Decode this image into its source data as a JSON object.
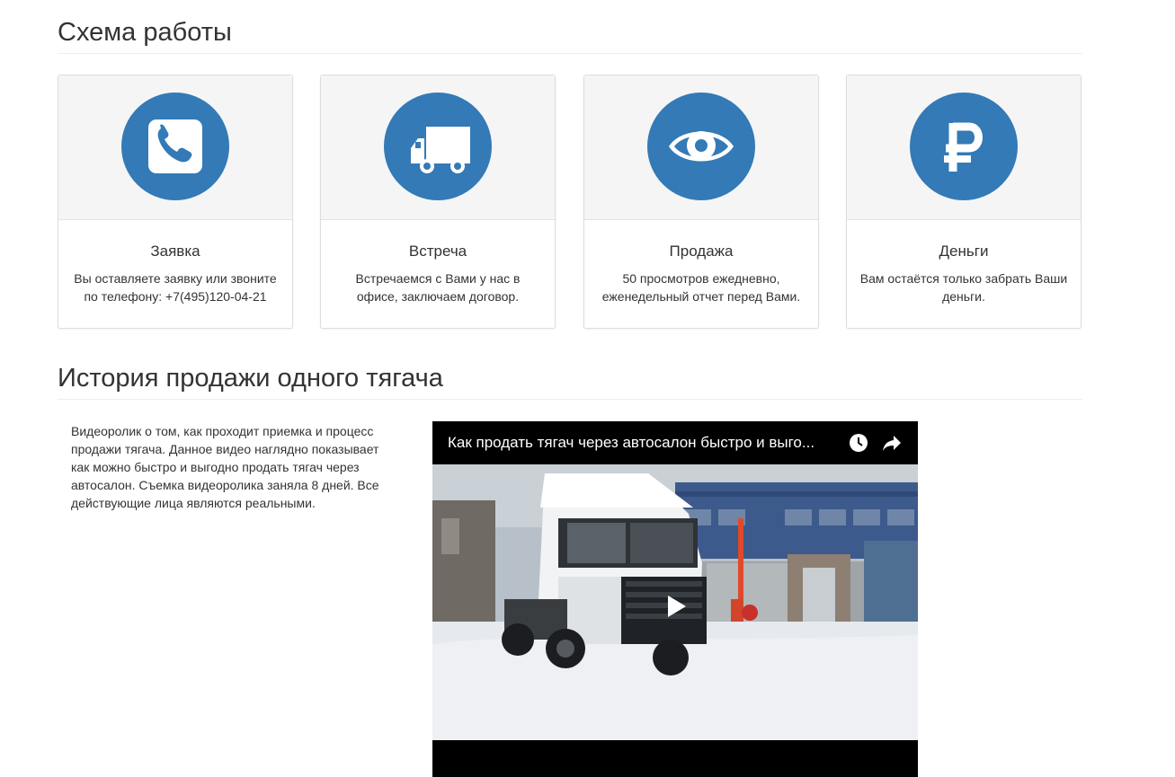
{
  "section1": {
    "title": "Схема работы"
  },
  "steps": [
    {
      "icon": "phone-icon",
      "title": "Заявка",
      "text": "Вы оставляете заявку или звоните по телефону: +7(495)120-04-21"
    },
    {
      "icon": "truck-icon",
      "title": "Встреча",
      "text": "Встречаемся с Вами у нас в офисе, заключаем договор."
    },
    {
      "icon": "eye-icon",
      "title": "Продажа",
      "text": "50 просмотров ежедневно, еженедельный отчет перед Вами."
    },
    {
      "icon": "ruble-icon",
      "title": "Деньги",
      "text": "Вам остаётся только забрать Ваши деньги."
    }
  ],
  "section2": {
    "title": "История продажи одного тягача",
    "description": "Видеоролик о том, как проходит приемка и процесс продажи тягача. Данное видео наглядно показывает как можно быстро и выгодно продать тягач через автосалон. Съемка видеоролика заняла 8 дней. Все действующие лица являются реальными."
  },
  "video": {
    "title": "Как продать тягач через автосалон быстро и выго...",
    "icons": [
      "clock-icon",
      "share-icon",
      "play-icon"
    ]
  },
  "colors": {
    "accent": "#337ab7",
    "card_top": "#f5f5f5",
    "text": "#333333"
  }
}
